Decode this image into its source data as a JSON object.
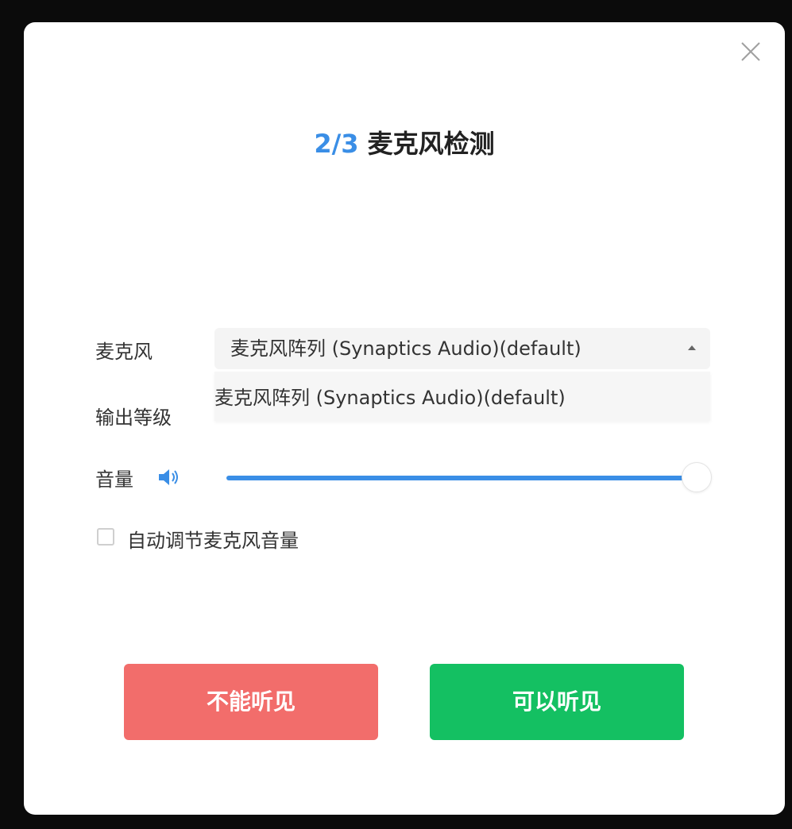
{
  "header": {
    "step": "2/3",
    "title": "麦克风检测"
  },
  "form": {
    "mic_label": "麦克风",
    "mic_selected": "麦克风阵列 (Synaptics Audio)(default)",
    "mic_options": [
      "麦克风阵列 (Synaptics Audio)(default)"
    ],
    "output_level_label": "输出等级",
    "volume_label": "音量",
    "volume_level": 1.0,
    "auto_adjust_label": "自动调节麦克风音量",
    "auto_adjust_checked": false
  },
  "actions": {
    "cannot_hear": "不能听见",
    "can_hear": "可以听见"
  },
  "colors": {
    "accent": "#3a8ee6",
    "danger": "#f26d6b",
    "success": "#14c062"
  },
  "icons": {
    "close": "close-icon",
    "volume": "speaker-icon",
    "dropdown": "caret-up-icon"
  }
}
